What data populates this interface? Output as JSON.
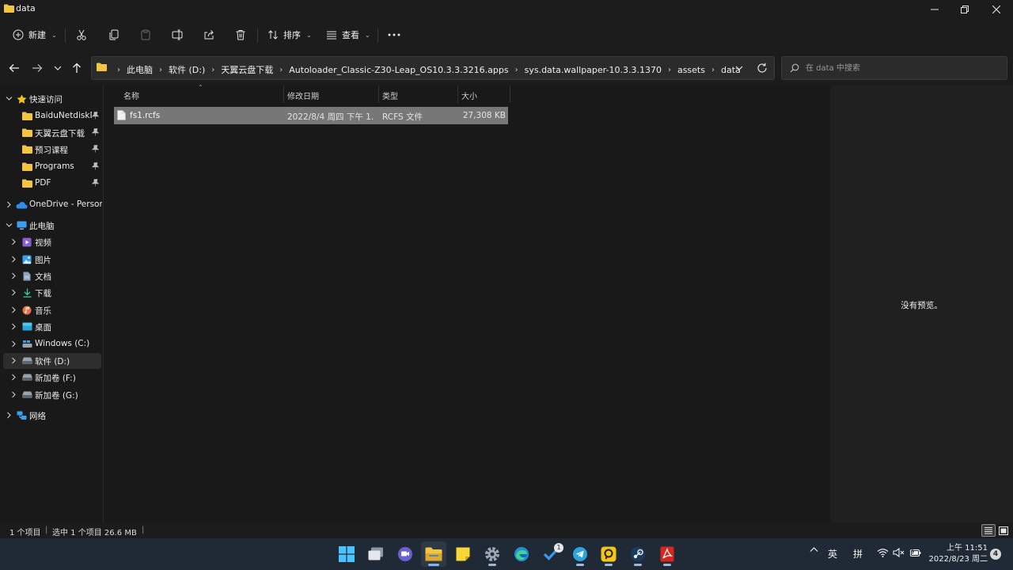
{
  "window": {
    "title": "data"
  },
  "toolbar": {
    "new_label": "新建",
    "sort_label": "排序",
    "view_label": "查看"
  },
  "address": {
    "crumbs": [
      "此电脑",
      "软件 (D:)",
      "天翼云盘下载",
      "Autoloader_Classic-Z30-Leap_OS10.3.3.3216.apps",
      "sys.data.wallpaper-10.3.3.1370",
      "assets",
      "data"
    ]
  },
  "search": {
    "placeholder": "在 data 中搜索"
  },
  "sidebar": {
    "quick_access": "快速访问",
    "pinned": [
      "BaiduNetdiskD",
      "天翼云盘下载",
      "预习课程",
      "Programs",
      "PDF"
    ],
    "onedrive": "OneDrive - Persona",
    "this_pc": "此电脑",
    "pc_items": [
      "视频",
      "图片",
      "文档",
      "下载",
      "音乐",
      "桌面",
      "Windows (C:)",
      "软件 (D:)",
      "新加卷 (F:)",
      "新加卷 (G:)"
    ],
    "network": "网络"
  },
  "columns": {
    "name": "名称",
    "date": "修改日期",
    "type": "类型",
    "size": "大小"
  },
  "files": [
    {
      "name": "fs1.rcfs",
      "date": "2022/8/4 周四 下午 1...",
      "type": "RCFS 文件",
      "size": "27,308 KB"
    }
  ],
  "preview": {
    "message": "没有预览。"
  },
  "status": {
    "count": "1 个项目",
    "selected": "选中 1 个项目  26.6 MB"
  },
  "taskbar": {
    "tray_ime_lang": "英",
    "tray_ime_mode": "拼",
    "time": "上午 11:51",
    "date": "2022/8/23 周二",
    "notification_count": "4",
    "todo_badge": "1"
  },
  "colors": {
    "accent_folder": "#f4c542",
    "selection": "#777777",
    "taskbar": "#202a36"
  }
}
